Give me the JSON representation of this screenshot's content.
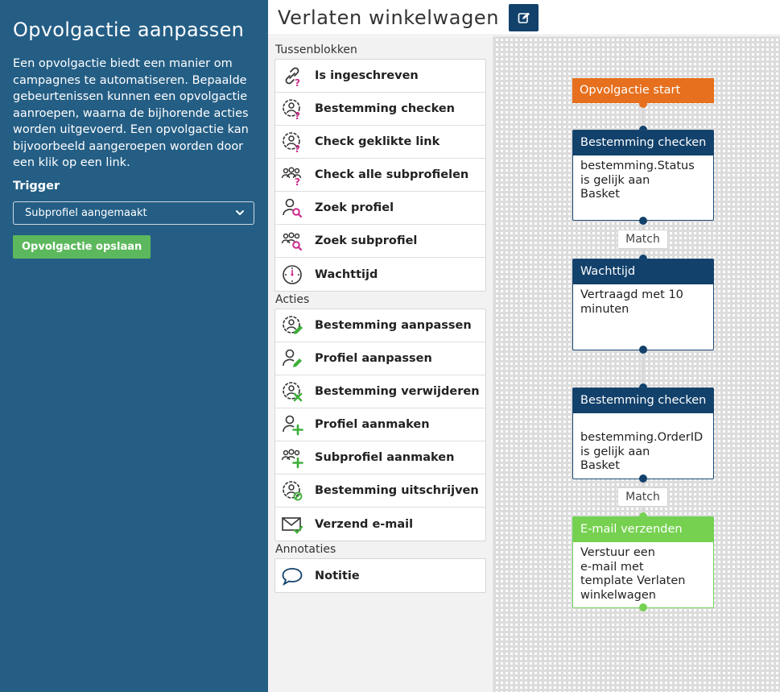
{
  "sidebar": {
    "title": "Opvolgactie aanpassen",
    "description": "Een opvolgactie biedt een manier om campagnes te automatiseren. Bepaalde gebeurtenissen kunnen een opvolgactie aanroepen, waarna de bijhorende acties worden uitgevoerd. Een opvolgactie kan bijvoorbeeld aangeroepen worden door een klik op een link.",
    "trigger_label": "Trigger",
    "trigger_value": "Subprofiel aangemaakt",
    "save_label": "Opvolgactie opslaan"
  },
  "header": {
    "title": "Verlaten winkelwagen",
    "edit_icon": "edit-icon"
  },
  "palette": {
    "sections": [
      {
        "title": "Tussenblokken",
        "items": [
          {
            "label": "Is ingeschreven",
            "icon": "link-question-icon"
          },
          {
            "label": "Bestemming checken",
            "icon": "target-question-icon"
          },
          {
            "label": "Check geklikte link",
            "icon": "link-check-icon"
          },
          {
            "label": "Check alle subprofielen",
            "icon": "group-question-icon"
          },
          {
            "label": "Zoek profiel",
            "icon": "profile-search-icon"
          },
          {
            "label": "Zoek subprofiel",
            "icon": "group-search-icon"
          },
          {
            "label": "Wachttijd",
            "icon": "clock-icon"
          }
        ]
      },
      {
        "title": "Acties",
        "items": [
          {
            "label": "Bestemming aanpassen",
            "icon": "target-edit-icon"
          },
          {
            "label": "Profiel aanpassen",
            "icon": "profile-edit-icon"
          },
          {
            "label": "Bestemming verwijderen",
            "icon": "target-delete-icon"
          },
          {
            "label": "Profiel aanmaken",
            "icon": "profile-add-icon"
          },
          {
            "label": "Subprofiel aanmaken",
            "icon": "group-add-icon"
          },
          {
            "label": "Bestemming uitschrijven",
            "icon": "target-unsubscribe-icon"
          },
          {
            "label": "Verzend e-mail",
            "icon": "email-send-icon"
          }
        ]
      },
      {
        "title": "Annotaties",
        "items": [
          {
            "label": "Notitie",
            "icon": "speech-bubble-icon"
          }
        ]
      }
    ]
  },
  "flow": {
    "start": {
      "title": "Opvolgactie start"
    },
    "node1": {
      "title": "Bestemming checken",
      "lines": [
        "bestemming.Status",
        "is gelijk aan",
        "Basket"
      ]
    },
    "match1": "Match",
    "node2": {
      "title": "Wachttijd",
      "lines": [
        "Vertraagd met 10",
        "minuten"
      ]
    },
    "node3": {
      "title": "Bestemming checken",
      "lines": [
        "bestemming.OrderID",
        "is gelijk aan",
        "Basket"
      ]
    },
    "match2": "Match",
    "node4": {
      "title": "E-mail verzenden",
      "lines": [
        "Verstuur een",
        "e-mail met",
        "template Verlaten",
        "winkelwagen"
      ]
    }
  },
  "colors": {
    "sidebar_bg": "#245e85",
    "navy": "#12416b",
    "orange": "#e6701e",
    "green": "#76d150",
    "save_button": "#5cb85c",
    "magenta_accent": "#cc2a8c",
    "green_accent": "#3fae3a"
  }
}
